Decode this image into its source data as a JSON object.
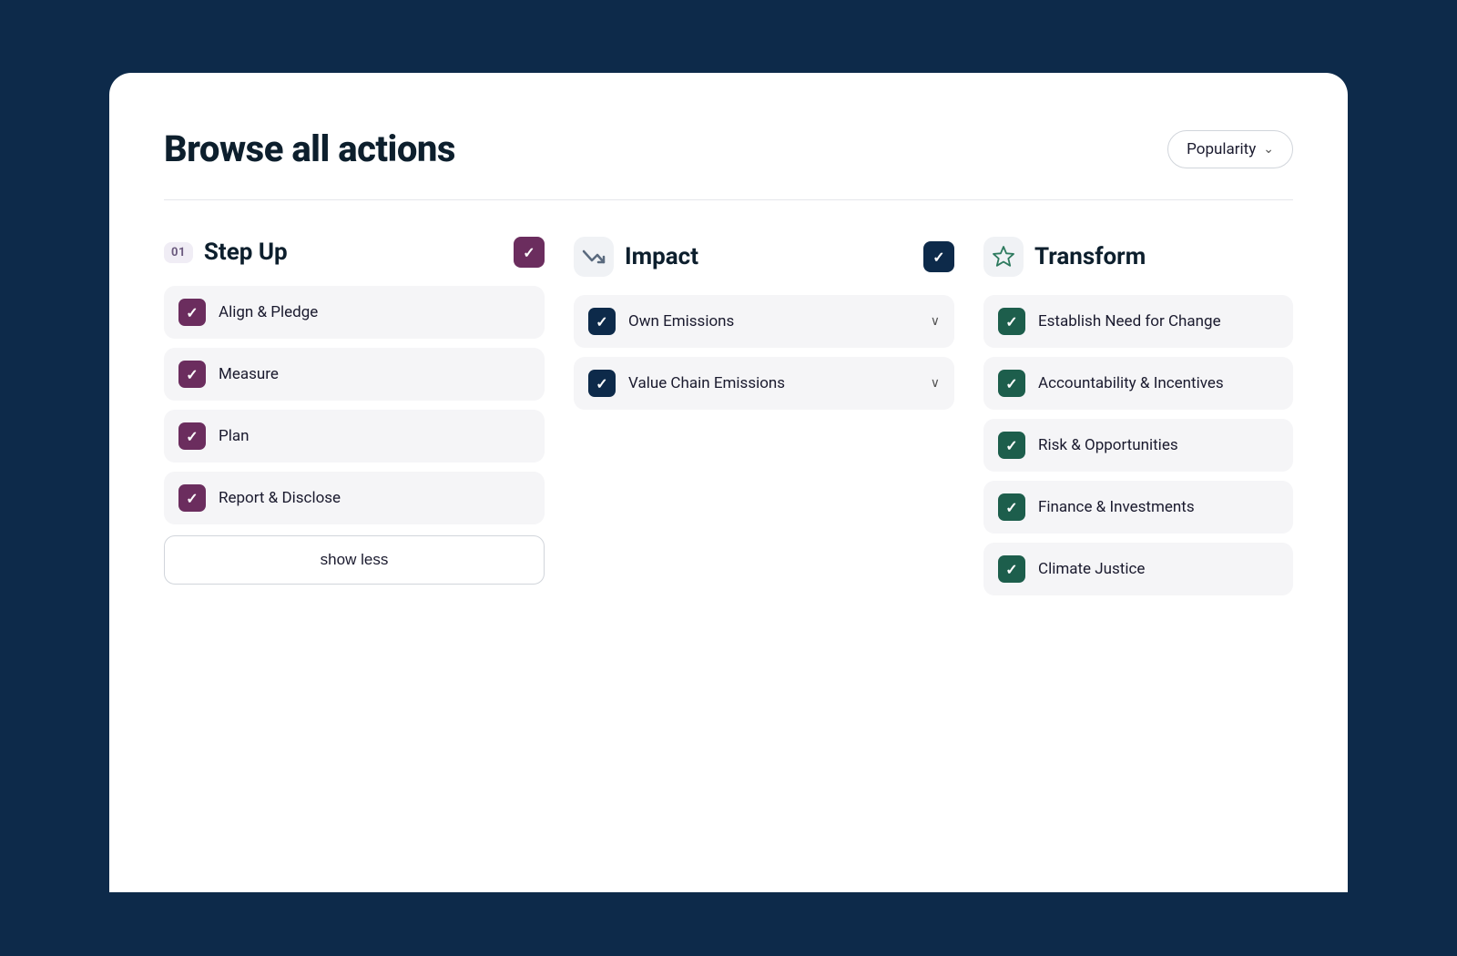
{
  "page": {
    "title": "Browse all actions",
    "sort_label": "Popularity"
  },
  "columns": [
    {
      "id": "step-up",
      "number": "01",
      "title": "Step Up",
      "icon_type": "number",
      "checkbox_color": "purple",
      "items": [
        {
          "label": "Align & Pledge",
          "checkbox_color": "purple"
        },
        {
          "label": "Measure",
          "checkbox_color": "purple"
        },
        {
          "label": "Plan",
          "checkbox_color": "purple"
        },
        {
          "label": "Report & Disclose",
          "checkbox_color": "purple"
        }
      ],
      "show_less_label": "show less"
    },
    {
      "id": "impact",
      "number": null,
      "title": "Impact",
      "icon_type": "trend-down",
      "checkbox_color": "dark-navy",
      "items": [
        {
          "label": "Own Emissions",
          "checkbox_color": "dark-navy",
          "has_chevron": true
        },
        {
          "label": "Value Chain Emissions",
          "checkbox_color": "dark-navy",
          "has_chevron": true
        }
      ],
      "show_less_label": null
    },
    {
      "id": "transform",
      "number": null,
      "title": "Transform",
      "icon_type": "star",
      "checkbox_color": "green",
      "items": [
        {
          "label": "Establish Need for Change",
          "checkbox_color": "green",
          "has_chevron": false
        },
        {
          "label": "Accountability & Incentives",
          "checkbox_color": "green",
          "has_chevron": false
        },
        {
          "label": "Risk & Opportunities",
          "checkbox_color": "green",
          "has_chevron": false
        },
        {
          "label": "Finance & Investments",
          "checkbox_color": "green",
          "has_chevron": false
        },
        {
          "label": "Climate Justice",
          "checkbox_color": "green",
          "has_chevron": false
        }
      ],
      "show_less_label": null
    }
  ]
}
